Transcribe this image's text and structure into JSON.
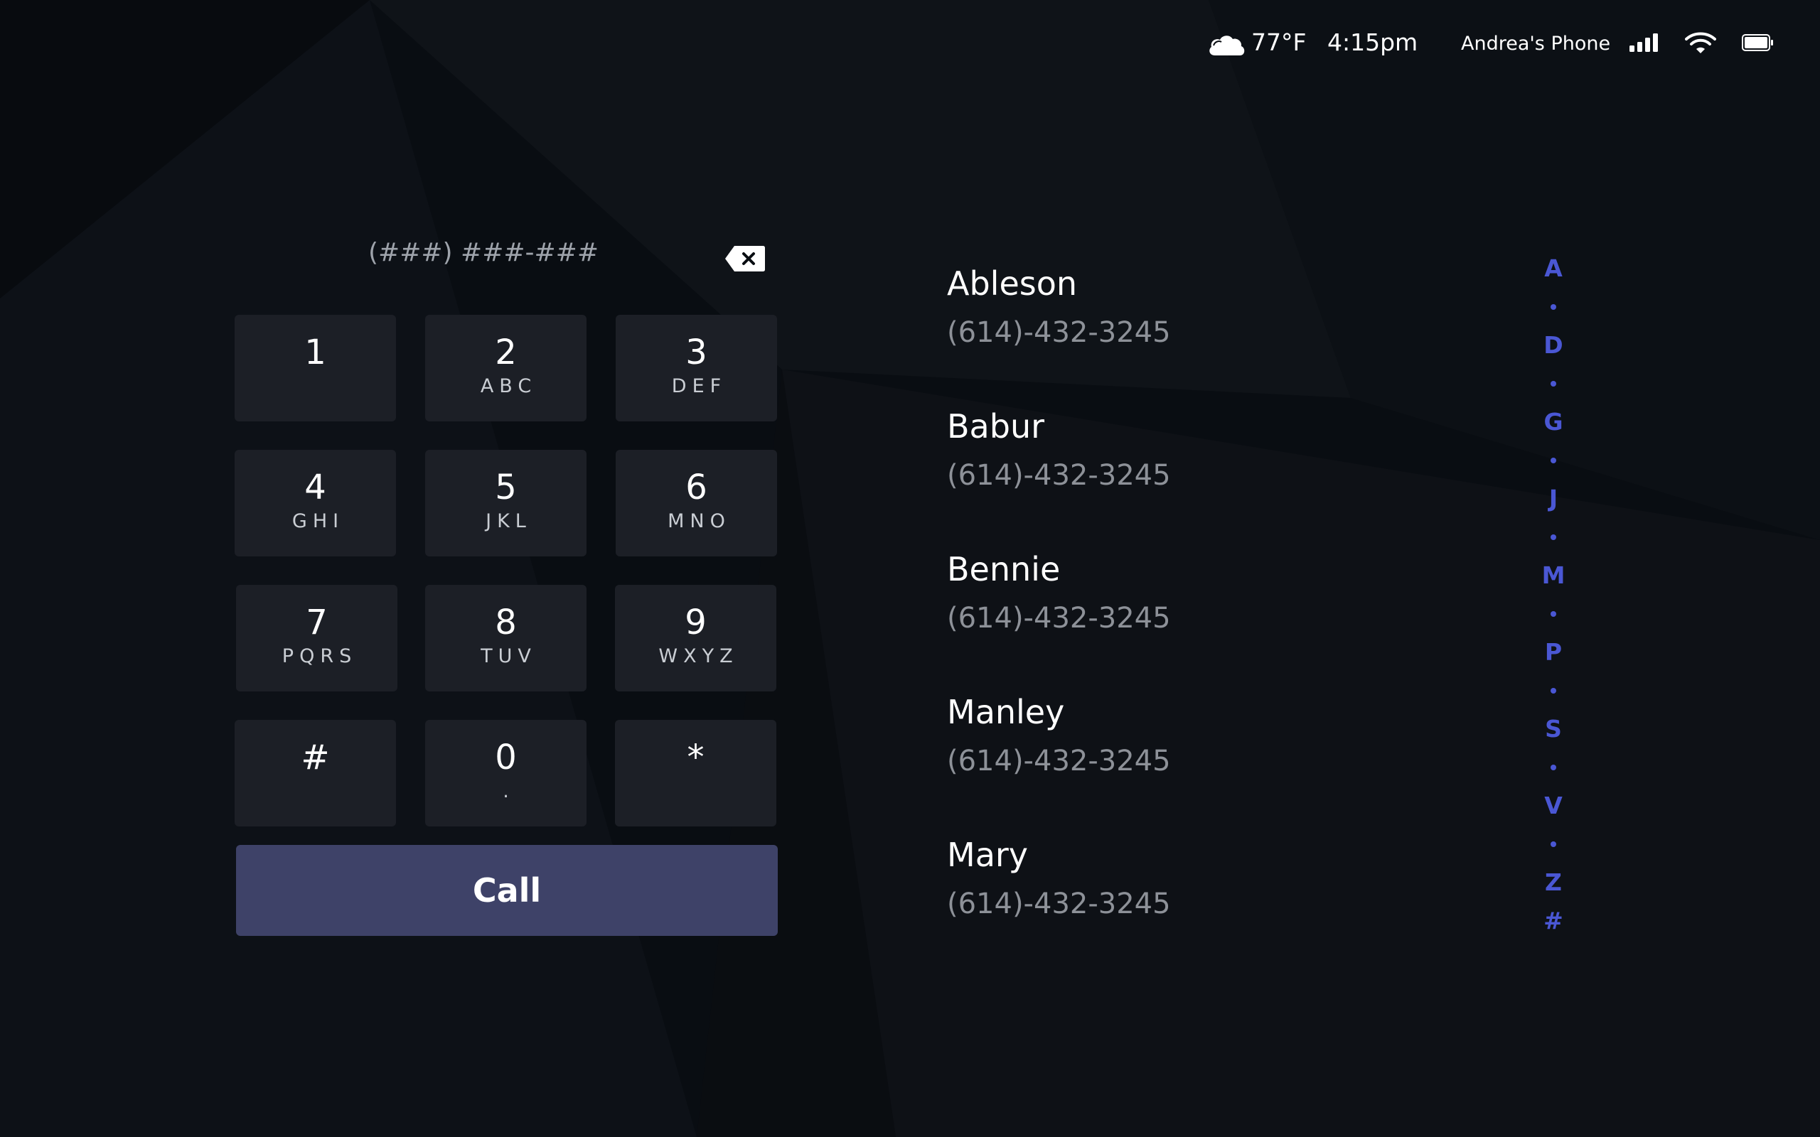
{
  "status_bar": {
    "weather_icon": "cloud-icon",
    "temperature": "77°F",
    "time": "4:15pm",
    "device_name": "Andrea's Phone",
    "signal_icon": "cellular-signal-icon",
    "wifi_icon": "wifi-icon",
    "battery_icon": "battery-icon"
  },
  "dialer": {
    "display_placeholder": "(###) ###-###",
    "backspace_icon": "backspace-icon",
    "keys": [
      {
        "digit": "1",
        "letters": ""
      },
      {
        "digit": "2",
        "letters": "ABC"
      },
      {
        "digit": "3",
        "letters": "DEF"
      },
      {
        "digit": "4",
        "letters": "GHI"
      },
      {
        "digit": "5",
        "letters": "JKL"
      },
      {
        "digit": "6",
        "letters": "MNO"
      },
      {
        "digit": "7",
        "letters": "PQRS"
      },
      {
        "digit": "8",
        "letters": "TUV"
      },
      {
        "digit": "9",
        "letters": "WXYZ"
      },
      {
        "digit": "#",
        "letters": ""
      },
      {
        "digit": "0",
        "letters": "."
      },
      {
        "digit": "*",
        "letters": ""
      }
    ],
    "call_label": "Call"
  },
  "contacts": [
    {
      "name": "Ableson",
      "phone": "(614)-432-3245"
    },
    {
      "name": "Babur",
      "phone": "(614)-432-3245"
    },
    {
      "name": "Bennie",
      "phone": "(614)-432-3245"
    },
    {
      "name": "Manley",
      "phone": "(614)-432-3245"
    },
    {
      "name": "Mary",
      "phone": "(614)-432-3245"
    }
  ],
  "alpha_index": [
    "A",
    "D",
    "G",
    "J",
    "M",
    "P",
    "S",
    "V",
    "Z",
    "#"
  ],
  "colors": {
    "background": "#090d12",
    "key_background": "#1c1f26",
    "call_button": "#3e4268",
    "accent": "#4a57d4",
    "phone_text": "#8d9198"
  }
}
